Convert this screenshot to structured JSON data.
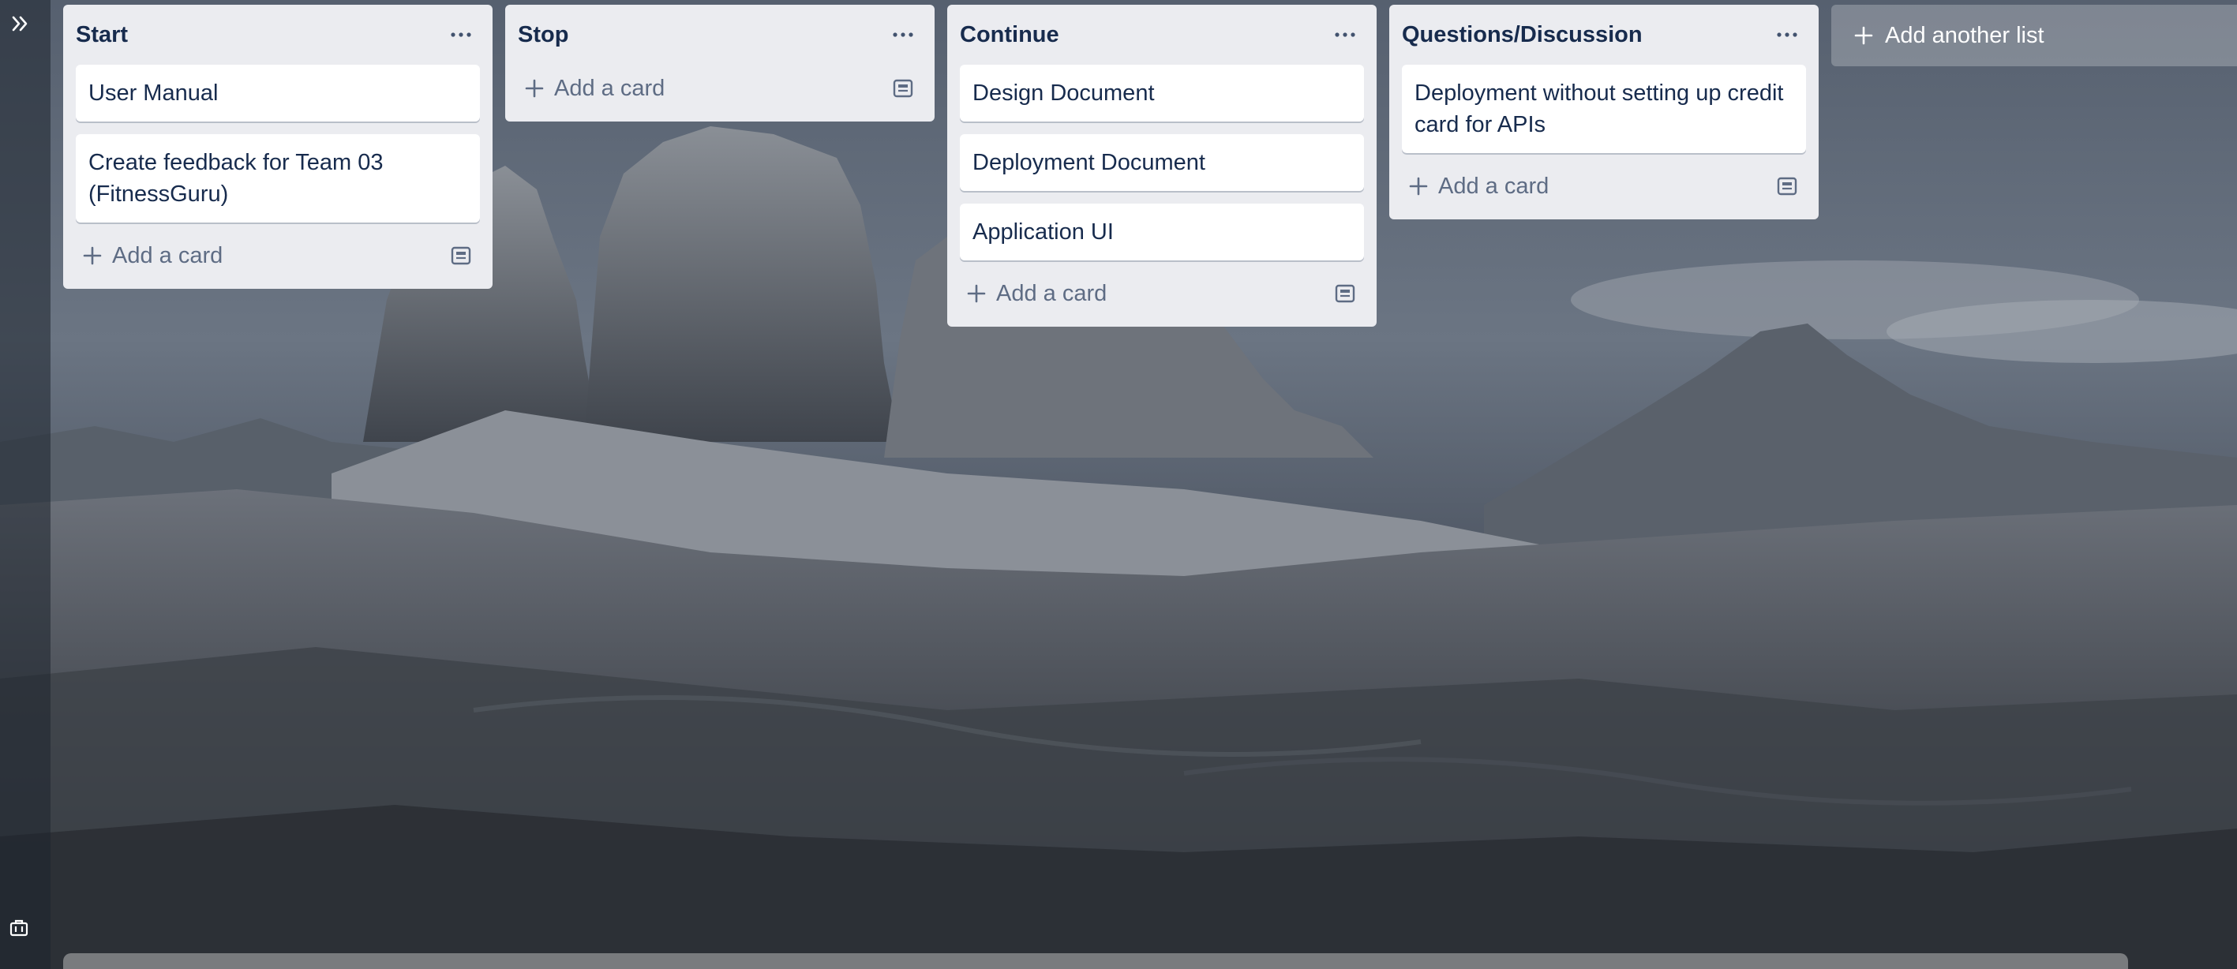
{
  "sidebar": {
    "expand_icon": "double-chevron-right-icon",
    "bottom_icon": "briefcase-icon"
  },
  "lists": [
    {
      "title": "Start",
      "cards": [
        "User Manual",
        "Create feedback for Team 03 (FitnessGuru)"
      ],
      "add_card_label": "Add a card"
    },
    {
      "title": "Stop",
      "cards": [],
      "add_card_label": "Add a card"
    },
    {
      "title": "Continue",
      "cards": [
        "Design Document",
        "Deployment Document",
        "Application UI"
      ],
      "add_card_label": "Add a card"
    },
    {
      "title": "Questions/Discussion",
      "cards": [
        "Deployment without setting up credit card for APIs"
      ],
      "add_card_label": "Add a card"
    }
  ],
  "add_list_label": "Add another list",
  "colors": {
    "list_bg": "#ebecf0",
    "card_bg": "#ffffff",
    "text": "#172b4d",
    "muted_text": "#5e6c84"
  }
}
